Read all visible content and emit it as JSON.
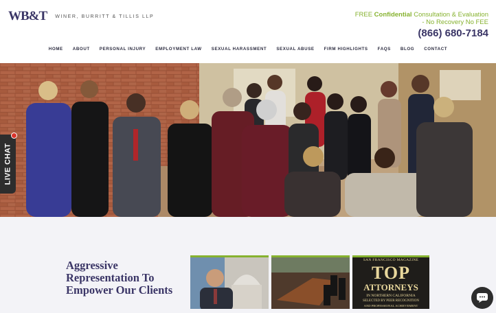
{
  "header": {
    "logo_mark": "WB&T",
    "logo_name": "WINER, BURRITT & TILLIS LLP",
    "promo_free": "FREE",
    "promo_confidential": "Confidential",
    "promo_rest": "Consultation & Evaluation",
    "promo_line2": "-  No Recovery No FEE",
    "phone": "(866) 680-7184"
  },
  "nav": [
    "HOME",
    "ABOUT",
    "PERSONAL INJURY",
    "EMPLOYMENT LAW",
    "SEXUAL HARASSMENT",
    "SEXUAL ABUSE",
    "FIRM HIGHLIGHTS",
    "FAQS",
    "BLOG",
    "CONTACT"
  ],
  "live_chat_label": "LIVE CHAT",
  "tagline": "Aggressive Representation To Empower Our Clients",
  "thumbs": {
    "magazine": "SAN FRANCISCO MAGAZINE",
    "top": "TOP",
    "attorneys": "ATTORNEYS",
    "sub1": "IN NORTHERN CALIFORNIA",
    "sub2": "SELECTED BY PEER RECOGNITION",
    "sub3": "AND PROFESSIONAL ACHIEVEMENT"
  },
  "colors": {
    "brand": "#3a3566",
    "accent": "#86b22f"
  }
}
